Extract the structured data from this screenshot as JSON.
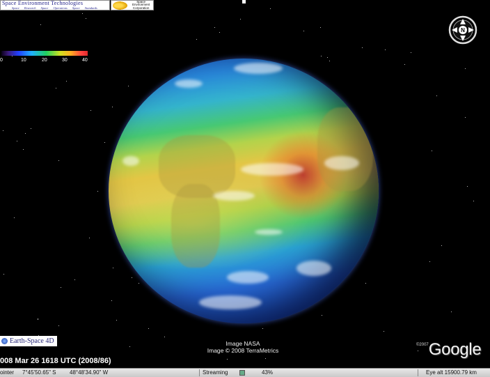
{
  "header": {
    "set_logo": {
      "title": "Space Environment Technologies",
      "tagline_1": "Space Research",
      "tagline_2": "Space Operations",
      "tagline_3": "Space Standards"
    },
    "sec_logo": {
      "line1": "Space",
      "line2": "Environment",
      "line3": "Corporation"
    }
  },
  "legend": {
    "ticks": [
      "0",
      "10",
      "20",
      "30",
      "40"
    ],
    "gradient_colors": [
      "#0a0018",
      "#3a1a7a",
      "#2040ff",
      "#1fb0ff",
      "#20d060",
      "#d0e020",
      "#ffb020",
      "#ff4040",
      "#e02a2a"
    ]
  },
  "compass": {
    "north_label": "N"
  },
  "overlay": {
    "earthspace_label": "Earth-Space 4D",
    "credit_line_1": "Image NASA",
    "credit_line_2": "Image © 2008 TerraMetrics",
    "timestamp": "008 Mar 26 1618 UTC (2008/86)",
    "google_copyright": "©2007",
    "google_logo": "Google"
  },
  "status_bar": {
    "pointer_label": "ointer",
    "pointer_lat": "7°45'50.65\" S",
    "pointer_lon": "48°48'34.90\" W",
    "streaming_label": "Streaming",
    "streaming_percent": "43%",
    "streaming_fraction": 0.43,
    "eye_alt": "Eye alt 15900.79 km"
  }
}
